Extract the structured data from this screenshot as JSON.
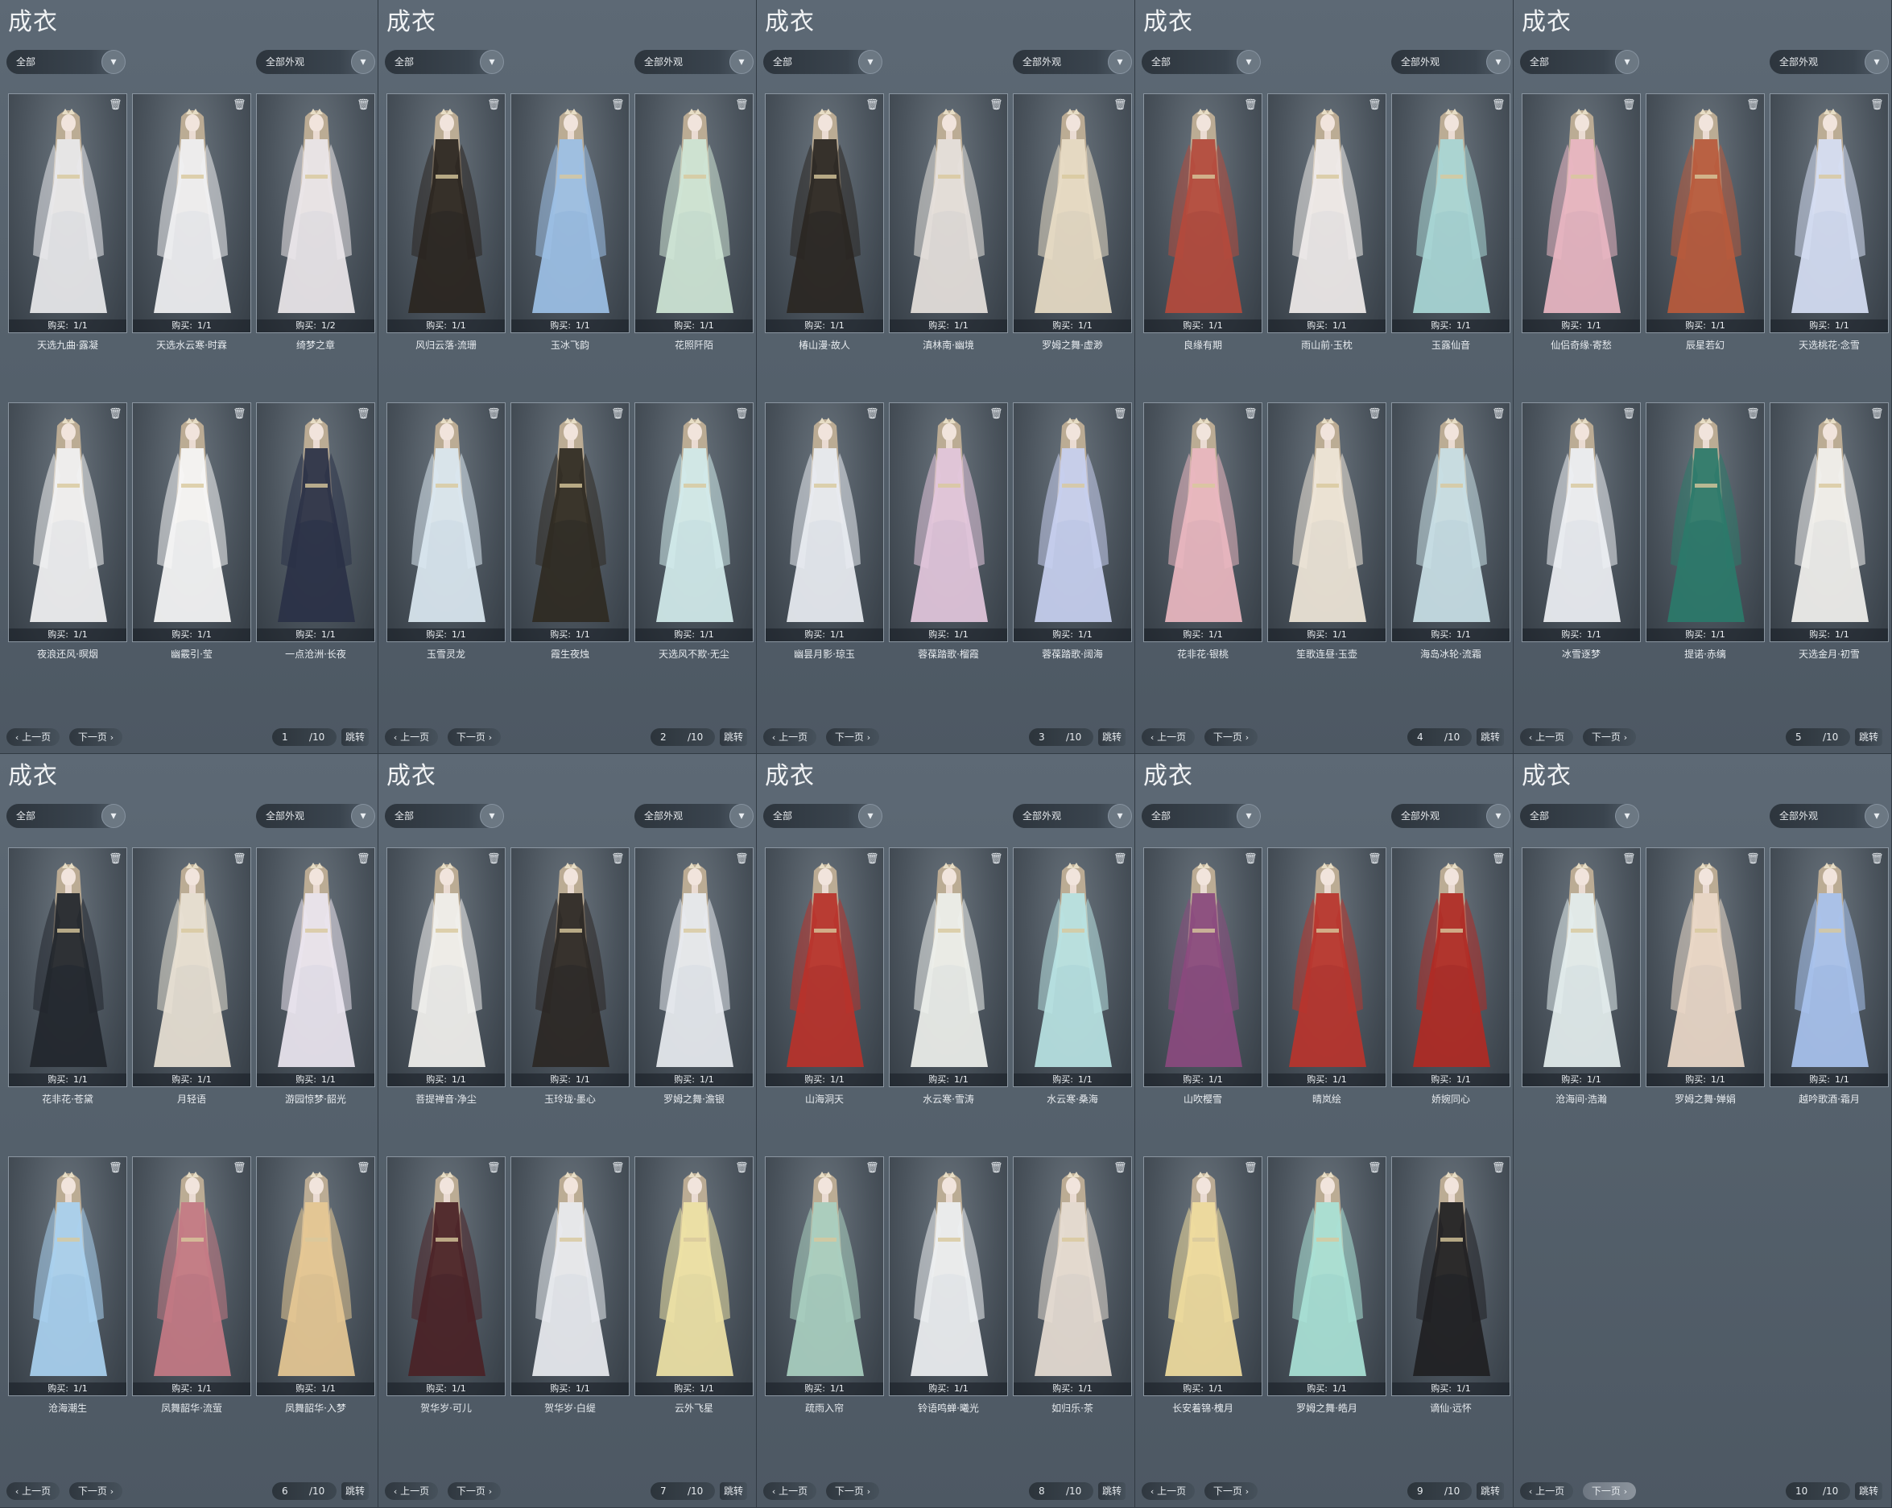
{
  "panels": [
    {
      "title": "成衣",
      "filter": "全部",
      "look_filter": "全部外观",
      "items": [
        {
          "name": "天选九曲·露凝",
          "buy": "1/1"
        },
        {
          "name": "天选水云寒·时霖",
          "buy": "1/1"
        },
        {
          "name": "绮梦之章",
          "buy": "1/2"
        },
        {
          "name": "夜浪还风·暝烟",
          "buy": "1/1"
        },
        {
          "name": "幽霰引·莹",
          "buy": "1/1"
        },
        {
          "name": "一点沧洲·长夜",
          "buy": "1/1"
        }
      ],
      "prev": "上一页",
      "next": "下一页",
      "page": "1",
      "total": "/10",
      "jump": "跳转"
    },
    {
      "title": "成衣",
      "filter": "全部",
      "look_filter": "全部外观",
      "items": [
        {
          "name": "风归云落·流珊",
          "buy": "1/1"
        },
        {
          "name": "玉冰飞韵",
          "buy": "1/1"
        },
        {
          "name": "花照阡陌",
          "buy": "1/1"
        },
        {
          "name": "玉雪灵龙",
          "buy": "1/1"
        },
        {
          "name": "霞生夜烛",
          "buy": "1/1"
        },
        {
          "name": "天选风不欺·无尘",
          "buy": "1/1"
        }
      ],
      "prev": "上一页",
      "next": "下一页",
      "page": "2",
      "total": "/10",
      "jump": "跳转"
    },
    {
      "title": "成衣",
      "filter": "全部",
      "look_filter": "全部外观",
      "items": [
        {
          "name": "椿山漫·故人",
          "buy": "1/1"
        },
        {
          "name": "滇林南·幽境",
          "buy": "1/1"
        },
        {
          "name": "罗姆之舞·虚渺",
          "buy": "1/1"
        },
        {
          "name": "幽昙月影·琼玉",
          "buy": "1/1"
        },
        {
          "name": "蓉葆踏歌·榴霞",
          "buy": "1/1"
        },
        {
          "name": "蓉葆踏歌·阔海",
          "buy": "1/1"
        }
      ],
      "prev": "上一页",
      "next": "下一页",
      "page": "3",
      "total": "/10",
      "jump": "跳转"
    },
    {
      "title": "成衣",
      "filter": "全部",
      "look_filter": "全部外观",
      "items": [
        {
          "name": "良缘有期",
          "buy": "1/1"
        },
        {
          "name": "雨山前·玉枕",
          "buy": "1/1"
        },
        {
          "name": "玉露仙音",
          "buy": "1/1"
        },
        {
          "name": "花非花·银桃",
          "buy": "1/1"
        },
        {
          "name": "笙歌连昼·玉壶",
          "buy": "1/1"
        },
        {
          "name": "海岛冰轮·流霜",
          "buy": "1/1"
        }
      ],
      "prev": "上一页",
      "next": "下一页",
      "page": "4",
      "total": "/10",
      "jump": "跳转"
    },
    {
      "title": "成衣",
      "filter": "全部",
      "look_filter": "全部外观",
      "items": [
        {
          "name": "仙侣奇缘·寄愁",
          "buy": "1/1"
        },
        {
          "name": "辰星若幻",
          "buy": "1/1"
        },
        {
          "name": "天选桃花·念雪",
          "buy": "1/1"
        },
        {
          "name": "冰雪逐梦",
          "buy": "1/1"
        },
        {
          "name": "提诺·赤缡",
          "buy": "1/1"
        },
        {
          "name": "天选金月·初雪",
          "buy": "1/1"
        }
      ],
      "prev": "上一页",
      "next": "下一页",
      "page": "5",
      "total": "/10",
      "jump": "跳转"
    },
    {
      "title": "成衣",
      "filter": "全部",
      "look_filter": "全部外观",
      "items": [
        {
          "name": "花非花·苍黛",
          "buy": "1/1"
        },
        {
          "name": "月轻语",
          "buy": "1/1"
        },
        {
          "name": "游园惊梦·韶光",
          "buy": "1/1"
        },
        {
          "name": "沧海潮生",
          "buy": "1/1"
        },
        {
          "name": "凤舞韶华·流萤",
          "buy": "1/1"
        },
        {
          "name": "凤舞韶华·入梦",
          "buy": "1/1"
        }
      ],
      "prev": "上一页",
      "next": "下一页",
      "page": "6",
      "total": "/10",
      "jump": "跳转"
    },
    {
      "title": "成衣",
      "filter": "全部",
      "look_filter": "全部外观",
      "items": [
        {
          "name": "菩提禅音·净尘",
          "buy": "1/1"
        },
        {
          "name": "玉玲珑·墨心",
          "buy": "1/1"
        },
        {
          "name": "罗姆之舞·澹银",
          "buy": "1/1"
        },
        {
          "name": "贺华岁·可儿",
          "buy": "1/1"
        },
        {
          "name": "贺华岁·白缇",
          "buy": "1/1"
        },
        {
          "name": "云外飞星",
          "buy": "1/1"
        }
      ],
      "prev": "上一页",
      "next": "下一页",
      "page": "7",
      "total": "/10",
      "jump": "跳转"
    },
    {
      "title": "成衣",
      "filter": "全部",
      "look_filter": "全部外观",
      "items": [
        {
          "name": "山海洞天",
          "buy": "1/1"
        },
        {
          "name": "水云寒·雪涛",
          "buy": "1/1"
        },
        {
          "name": "水云寒·桑海",
          "buy": "1/1"
        },
        {
          "name": "疏雨入帘",
          "buy": "1/1"
        },
        {
          "name": "铃语鸣蝉·曦光",
          "buy": "1/1"
        },
        {
          "name": "如归乐·茶",
          "buy": "1/1"
        }
      ],
      "prev": "上一页",
      "next": "下一页",
      "page": "8",
      "total": "/10",
      "jump": "跳转"
    },
    {
      "title": "成衣",
      "filter": "全部",
      "look_filter": "全部外观",
      "items": [
        {
          "name": "山吹樱雪",
          "buy": "1/1"
        },
        {
          "name": "晴岚绘",
          "buy": "1/1"
        },
        {
          "name": "娇婉同心",
          "buy": "1/1"
        },
        {
          "name": "长安着锦·槐月",
          "buy": "1/1"
        },
        {
          "name": "罗姆之舞·皓月",
          "buy": "1/1"
        },
        {
          "name": "谪仙·远怀",
          "buy": "1/1"
        }
      ],
      "prev": "上一页",
      "next": "下一页",
      "page": "9",
      "total": "/10",
      "jump": "跳转"
    },
    {
      "title": "成衣",
      "filter": "全部",
      "look_filter": "全部外观",
      "items": [
        {
          "name": "沧海间·浩瀚",
          "buy": "1/1"
        },
        {
          "name": "罗姆之舞·婵娟",
          "buy": "1/1"
        },
        {
          "name": "越吟歌酒·霜月",
          "buy": "1/1"
        }
      ],
      "prev": "上一页",
      "next": "下一页",
      "page": "10",
      "total": "/10",
      "jump": "跳转"
    }
  ],
  "ui": {
    "buy_label": "购买:",
    "trash_icon": "trash-icon",
    "dropdown_icon": "chevron-down-icon",
    "outfit_colors": [
      [
        "#e9e9ec",
        "#f1f1f3",
        "#ece7ea",
        "#f2f2f3",
        "#f7f7f7",
        "#2a3147"
      ],
      [
        "#2a2520",
        "#9cc0e6",
        "#cfe6d6",
        "#dbe8f1",
        "#2f2a22",
        "#d2ecec"
      ],
      [
        "#2a2622",
        "#e6e1dc",
        "#e8dcc6",
        "#e9edf2",
        "#e3c7dc",
        "#c8d0f0"
      ],
      [
        "#b44a3c",
        "#f0ecea",
        "#a9d7d6",
        "#eab7c0",
        "#efe6d8",
        "#c9e0e6"
      ],
      [
        "#e9b6c2",
        "#b85a3c",
        "#d6def4",
        "#eef0f4",
        "#2b7a6a",
        "#f2f1ee"
      ],
      [
        "#22262d",
        "#e8e1d4",
        "#ece6f0",
        "#a9d1f0",
        "#c47a84",
        "#e6c894"
      ],
      [
        "#f2f1ee",
        "#2b2724",
        "#e8ebf0",
        "#4a2226",
        "#e9ecf0",
        "#efe3a6"
      ],
      [
        "#b8322a",
        "#eef0ec",
        "#b9e3e3",
        "#a9cfc0",
        "#eef0f2",
        "#e6dcd2"
      ],
      [
        "#8a4a7e",
        "#b8342c",
        "#b02a24",
        "#f0dc9e",
        "#a9e2d6",
        "#1f1f22"
      ],
      [
        "#e4eeee",
        "#ead8c8",
        "#a8c2ee"
      ]
    ]
  }
}
